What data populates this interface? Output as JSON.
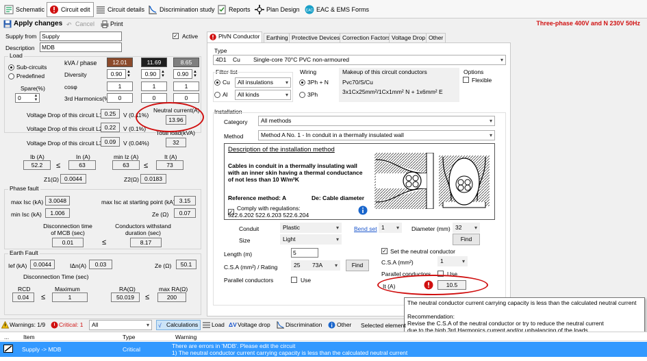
{
  "toolbar_tabs": [
    {
      "label": "Schematic",
      "icon": "schematic-icon"
    },
    {
      "label": "Circuit edit",
      "icon": "error-icon"
    },
    {
      "label": "Circuit details",
      "icon": "list-icon"
    },
    {
      "label": "Discrimination study",
      "icon": "curve-icon"
    },
    {
      "label": "Reports",
      "icon": "report-icon"
    },
    {
      "label": "Plan Design",
      "icon": "plan-icon"
    },
    {
      "label": "EAC & EMS Forms",
      "icon": "forms-icon"
    }
  ],
  "actions": {
    "apply": "Apply changes",
    "cancel": "Cancel",
    "print": "Print"
  },
  "system_label": "Three-phase 400V and N 230V 50Hz",
  "left": {
    "supply_from_label": "Supply from",
    "supply_from": "Supply",
    "description_label": "Description",
    "description": "MDB",
    "active_label": "Active",
    "load": {
      "title": "Load",
      "sub_circuits": "Sub-circuits",
      "predefined": "Predefined",
      "spare_label": "Spare(%)",
      "spare_value": "0",
      "kva_label": "kVA / phase",
      "kva": [
        "12.01",
        "11.69",
        "8.65"
      ],
      "diversity_label": "Diversity",
      "diversity": [
        "0.90",
        "0.90",
        "0.90"
      ],
      "cos_label": "cosφ",
      "cos": [
        "1",
        "1",
        "1"
      ],
      "harm_label": "3rd Harmonics(%)",
      "harm": [
        "0",
        "0",
        "0"
      ],
      "kva_colors": [
        "#8b4a2b",
        "#1e1e1e",
        "#7f7f7f"
      ]
    },
    "vdrop": {
      "l1_label": "Voltage Drop of this circuit L1",
      "l1": "0.25",
      "l1_pct": "V (0.11%)",
      "l2_label": "Voltage Drop of this circuit L2",
      "l2": "0.22",
      "l2_pct": "V (0.1%)",
      "l3_label": "Voltage Drop of this circuit L3",
      "l3": "0.09",
      "l3_pct": "V (0.04%)",
      "neutral_label": "Neutral current(A)",
      "neutral": "13.96",
      "total_label": "Total load(kVA)",
      "total": "32"
    },
    "currents": {
      "ib_label": "Ib (A)",
      "ib": "52.2",
      "in_label": "In (A)",
      "in": "63",
      "iz_label": "min Iz (A)",
      "iz": "63",
      "it_label": "It (A)",
      "it": "73",
      "le": "≤",
      "z1_label": "Z1(Ω)",
      "z1": "0.0044",
      "z2_label": "Z2(Ω)",
      "z2": "0.0183"
    },
    "phase_fault": {
      "title": "Phase fault",
      "max_isc_label": "max Isc (kA)",
      "max_isc": "3.0048",
      "max_isc_start_label": "max Isc at starting point (kA)",
      "max_isc_start": "3.15",
      "min_isc_label": "min Isc (kA)",
      "min_isc": "1.006",
      "ze_label": "Ze (Ω)",
      "ze": "0.07",
      "disc_label": "Disconnection time of MCB (sec)",
      "disc": "0.01",
      "withstand_label": "Conductors withstand duration (sec)",
      "withstand": "8.17"
    },
    "earth_fault": {
      "title": "Earth Fault",
      "ief_label": "Ief (kA)",
      "ief": "0.0044",
      "idn_label": "IΔn(A)",
      "idn": "0.03",
      "ze_label": "Ze (Ω)",
      "ze": "50.1",
      "disc_title": "Disconnection Time (sec)",
      "rcd_label": "RCD",
      "rcd": "0.04",
      "max_label": "Maximum",
      "max": "1",
      "ra_label": "RA(Ω)",
      "ra": "50.019",
      "maxra_label": "max RA(Ω)",
      "maxra": "200"
    }
  },
  "right": {
    "subtabs": [
      "Ph/N Conductor",
      "Earthing",
      "Protective Devices",
      "Correction Factors",
      "Voltage Drop",
      "Other"
    ],
    "type_label": "Type",
    "type_code": "4D1",
    "type_mat": "Cu",
    "type_desc": "Single-core 70°C PVC non-armoured",
    "filter_label": "Filter list",
    "filter_cu": "Cu",
    "filter_al": "Al",
    "filter_ins": "All insulations",
    "filter_kinds": "All kinds",
    "wiring_label": "Wiring",
    "wiring_3phn": "3Ph + N",
    "wiring_3ph": "3Ph",
    "makeup_label": "Makeup of this circuit conductors",
    "makeup_1": "Pvc70/S/Cu",
    "makeup_2": "3x1Cx25mm²/1Cx1mm² N + 1x6mm² E",
    "options_label": "Options",
    "flexible": "Flexible",
    "install_label": "Installation",
    "category_label": "Category",
    "category": "All methods",
    "method_label": "Method",
    "method": "Method A No. 1    -    In conduit in a thermally insulated wall",
    "desc_title": "Description of the installation method",
    "desc_body": "Cables in conduit in a thermally insulating wall with an inner skin having a thermal conductance of not less than 10 W/m²K",
    "ref_method": "Reference method: A",
    "de_label": "De: Cable diameter",
    "comply_label": "Comply with regulations:",
    "comply_refs": "522.6.202 522.6.203 522.6.204",
    "conduit_label": "Conduit",
    "conduit": "Plastic",
    "size_label": "Size",
    "size": "Light",
    "bend_set": "Bend set",
    "bend_value": "1",
    "diameter_label": "Diameter (mm)",
    "diameter": "32",
    "find": "Find",
    "length_label": "Length (m)",
    "length": "5",
    "csa_label": "C.S.A (mm²) / Rating",
    "csa": "25",
    "rating": "73A",
    "parallel_label": "Parallel conductors",
    "use": "Use",
    "set_neutral": "Set the neutral conductor",
    "n_csa_label": "C.S.A (mm²)",
    "n_csa": "1",
    "n_parallel_label": "Parallel conductors",
    "it_label": "It (A)",
    "it": "10.5"
  },
  "tooltip": {
    "line1": "The neutral conductor current carrying capacity is less than the calculated neutral current",
    "rec_title": "Recommendation:",
    "rec_1": "Revise the C.S.A of the neutral conductor or try to reduce the neutral current",
    "rec_2": "due to the high 3rd Harmonics current and/or unbalancing of the loads"
  },
  "bottom": {
    "warnings": "Warnings: 1/9",
    "critical": "Critical: 1",
    "filter": "All",
    "calc": "Calculations",
    "load": "Load",
    "vdrop": "Voltage drop",
    "disc": "Discrimination",
    "other": "Other",
    "selected": "Selected element",
    "col_dots": "...",
    "col_item": "Item",
    "col_type": "Type",
    "col_warning": "Warning",
    "row_item": "Supply -> MDB",
    "row_type": "Critical",
    "row_w1": "There are errors in 'MDB'. Please edit the circuit",
    "row_w2": "1) The neutral conductor current carrying capacity is less than the calculated neutral current"
  },
  "colors": {
    "accent_red": "#d01010",
    "selection": "#3399ff",
    "critical": "#e02020"
  }
}
